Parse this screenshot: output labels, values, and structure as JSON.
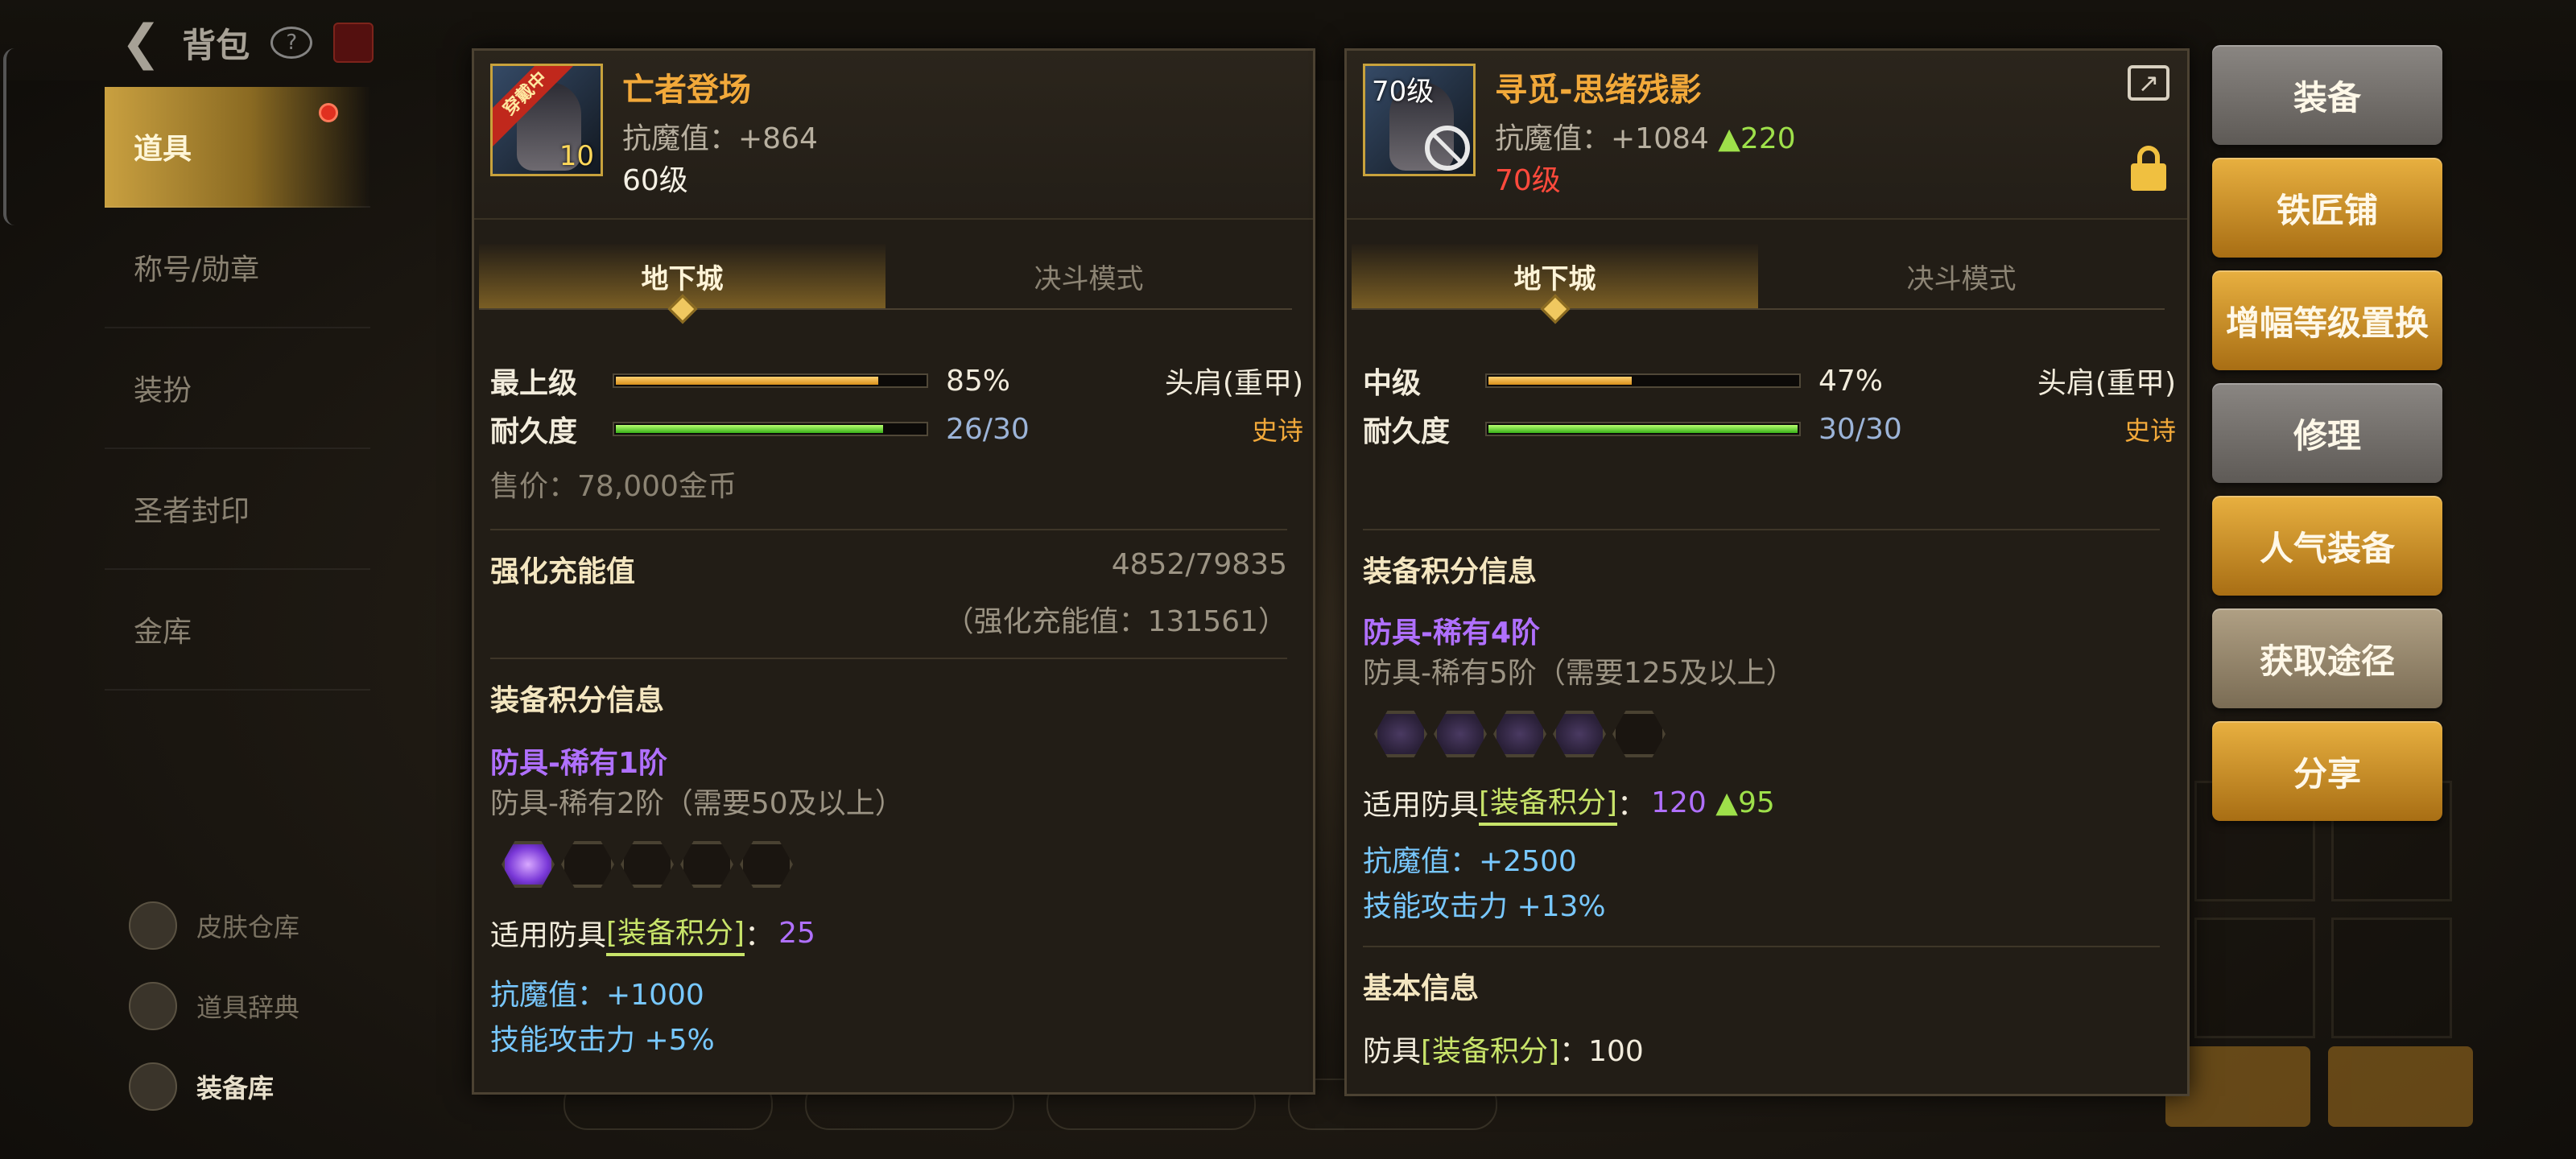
{
  "topbar": {
    "back_title": "背包"
  },
  "sidebar": {
    "items": [
      {
        "label": "道具",
        "active": true
      },
      {
        "label": "称号/勋章"
      },
      {
        "label": "装扮"
      },
      {
        "label": "圣者封印"
      },
      {
        "label": "金库"
      }
    ],
    "bottom_items": [
      {
        "label": "皮肤仓库"
      },
      {
        "label": "道具辞典"
      },
      {
        "label": "装备库"
      }
    ]
  },
  "left_panel": {
    "name": "亡者登场",
    "badge": "穿戴中",
    "icon_level": "10",
    "resist_label": "抗魔值：",
    "resist_value": "+864",
    "level": "60级",
    "tabs": [
      "地下城",
      "决斗模式"
    ],
    "grade_label": "最上级",
    "grade_pct_text": "85%",
    "grade_fraction": 0.85,
    "durability_label": "耐久度",
    "durability_text": "26/30",
    "durability_fraction": 0.8667,
    "slot": "头肩(重甲)",
    "rarity": "史诗",
    "price": "售价：78,000金币",
    "enhance_title": "强化充能值",
    "enhance_value": "4852/79835",
    "enhance_sub": "（强化充能值：131561）",
    "score_title": "装备积分信息",
    "tier_current": "防具-稀有1阶",
    "tier_next": "防具-稀有2阶（需要50及以上）",
    "hex_filled": 1,
    "hex_total": 5,
    "score_prefix": "适用防具",
    "score_tag": "[装备积分]",
    "score_colon": "：",
    "score_value": "25",
    "bonus_resist": "抗魔值：+1000",
    "bonus_skill": "技能攻击力 +5%"
  },
  "right_panel": {
    "name": "寻觅-思绪残影",
    "icon_level": "70级",
    "resist_label": "抗魔值：",
    "resist_value": "+1084",
    "resist_up": "▲220",
    "level": "70级",
    "tabs": [
      "地下城",
      "决斗模式"
    ],
    "grade_label": "中级",
    "grade_pct_text": "47%",
    "grade_fraction": 0.47,
    "durability_label": "耐久度",
    "durability_text": "30/30",
    "durability_fraction": 1.0,
    "slot": "头肩(重甲)",
    "rarity": "史诗",
    "score_title": "装备积分信息",
    "tier_current": "防具-稀有4阶",
    "tier_next": "防具-稀有5阶（需要125及以上）",
    "hex_filled": 4,
    "hex_total": 5,
    "score_prefix": "适用防具",
    "score_tag": "[装备积分]",
    "score_colon": "：",
    "score_value": "120",
    "score_up": "▲95",
    "bonus_resist": "抗魔值：+2500",
    "bonus_skill": "技能攻击力 +13%",
    "base_title": "基本信息",
    "base_prefix": "防具",
    "base_tag": "[装备积分]",
    "base_value": "：100"
  },
  "actions": [
    {
      "label": "装备",
      "style": "grey"
    },
    {
      "label": "铁匠铺",
      "style": "gold"
    },
    {
      "label": "增幅等级置换",
      "style": "gold"
    },
    {
      "label": "修理",
      "style": "grey"
    },
    {
      "label": "人气装备",
      "style": "gold"
    },
    {
      "label": "获取途径",
      "style": "khaki"
    },
    {
      "label": "分享",
      "style": "gold"
    }
  ],
  "colors": {
    "gold_text": "#f2a93a",
    "purple_tier": "#b070ff",
    "green_up": "#9ee04a",
    "blue_bonus": "#78c8ff",
    "red_level": "#ff4a3c"
  }
}
